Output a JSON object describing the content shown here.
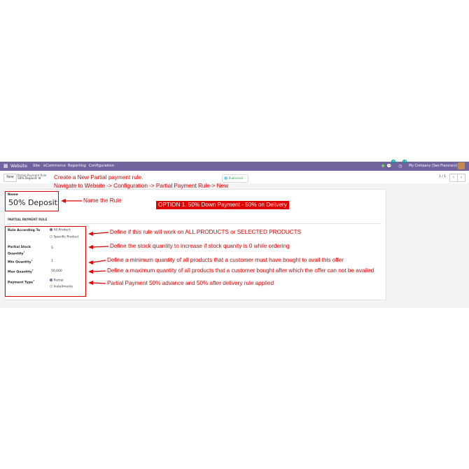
{
  "navbar": {
    "app_name": "Website",
    "menu": [
      "Site",
      "eCommerce",
      "Reporting",
      "Configuration"
    ],
    "chat_badge": "10",
    "activity_badge": "24",
    "company": "My Company (San Francisco)"
  },
  "control": {
    "new_label": "New",
    "breadcrumb_parent": "Partial Payment Rule",
    "breadcrumb_current": "50% Deposit",
    "published_label": "Published",
    "pager": "1 / 1"
  },
  "form": {
    "name_label": "Name",
    "name_value": "50% Deposit",
    "section_title": "PARTIAL PAYMENT RULE",
    "rule_label": "Rule According To",
    "rule_options": [
      "All Product",
      "Specific Product"
    ],
    "stock_label_line1": "Partial Stock",
    "stock_label_line2": "Quantity",
    "stock_value": "5",
    "min_label": "Min Quantity",
    "min_value": "1",
    "max_label": "Max Quantity",
    "max_value": "50,000",
    "payment_label": "Payment Type",
    "payment_options": [
      "Partial",
      "Installments"
    ],
    "help_mark": "?"
  },
  "annotations": {
    "create_line1": "Create a New Partial payment rule.",
    "create_line2": "Navigate to Website -> Configuration -> Partial Payment Rule-> New",
    "name_rule": "Name the Rule",
    "option": "OPTION 1. 50% Down Payment - 50% on Delivery",
    "rule_according": "Define if this rule will work on ALL PRODUCTS or SELECTED PRODUCTS",
    "stock": "Define the stock quantity to increase if stock quanity is 0 while ordering",
    "min": "Define a minimum quantity of all products that a customer must have bought to avail this offer",
    "max": "Define a maximum quantity of all products that a customer bought after which the offer can not be availed",
    "payment": "Partial Payment 50% advance and 50% after delivery rule applied"
  },
  "colors": {
    "navbar": "#71639e",
    "annotation": "#d40000",
    "option_badge": "#e00000"
  }
}
